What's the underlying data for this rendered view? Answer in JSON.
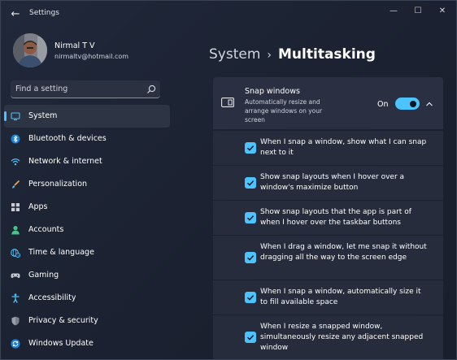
{
  "window": {
    "title": "Settings",
    "back_glyph": "←",
    "minimize_glyph": "—",
    "maximize_glyph": "☐",
    "close_glyph": "✕"
  },
  "user": {
    "name": "Nirmal T V",
    "email": "nirmaltv@hotmail.com"
  },
  "search": {
    "placeholder": "Find a setting",
    "icon": "search-icon"
  },
  "sidebar": {
    "items": [
      {
        "label": "System",
        "icon": "system-icon",
        "color": "#4cc2ff",
        "selected": true
      },
      {
        "label": "Bluetooth & devices",
        "icon": "bluetooth-icon",
        "color": "#4cc2ff"
      },
      {
        "label": "Network & internet",
        "icon": "wifi-icon",
        "color": "#4cc2ff"
      },
      {
        "label": "Personalization",
        "icon": "brush-icon",
        "color": "#e8a25a"
      },
      {
        "label": "Apps",
        "icon": "apps-icon",
        "color": "#c9ccd3"
      },
      {
        "label": "Accounts",
        "icon": "person-icon",
        "color": "#47c38a"
      },
      {
        "label": "Time & language",
        "icon": "globe-clock-icon",
        "color": "#4cc2ff"
      },
      {
        "label": "Gaming",
        "icon": "controller-icon",
        "color": "#c9ccd3"
      },
      {
        "label": "Accessibility",
        "icon": "accessibility-icon",
        "color": "#4cc2ff"
      },
      {
        "label": "Privacy & security",
        "icon": "shield-icon",
        "color": "#9aa0ab"
      },
      {
        "label": "Windows Update",
        "icon": "update-icon",
        "color": "#4cc2ff"
      }
    ]
  },
  "breadcrumb": {
    "parent": "System",
    "separator": "›",
    "current": "Multitasking"
  },
  "snap": {
    "title": "Snap windows",
    "description": "Automatically resize and arrange windows on your screen",
    "toggle_label": "On",
    "enabled": true,
    "expanded": true
  },
  "options": [
    {
      "label": "When I snap a window, show what I can snap next to it",
      "checked": true
    },
    {
      "label": "Show snap layouts when I hover over a window's maximize button",
      "checked": true
    },
    {
      "label": "Show snap layouts that the app is part of when I hover over the taskbar buttons",
      "checked": true
    },
    {
      "label": "When I drag a window, let me snap it without dragging all the way to the screen edge",
      "checked": true
    },
    {
      "label": "When I snap a window, automatically size it to fill available space",
      "checked": true
    },
    {
      "label": "When I resize a snapped window, simultaneously resize any adjacent snapped window",
      "checked": true
    }
  ],
  "colors": {
    "accent": "#4cc2ff",
    "background": "#1c2230",
    "card": "#2a3041"
  }
}
